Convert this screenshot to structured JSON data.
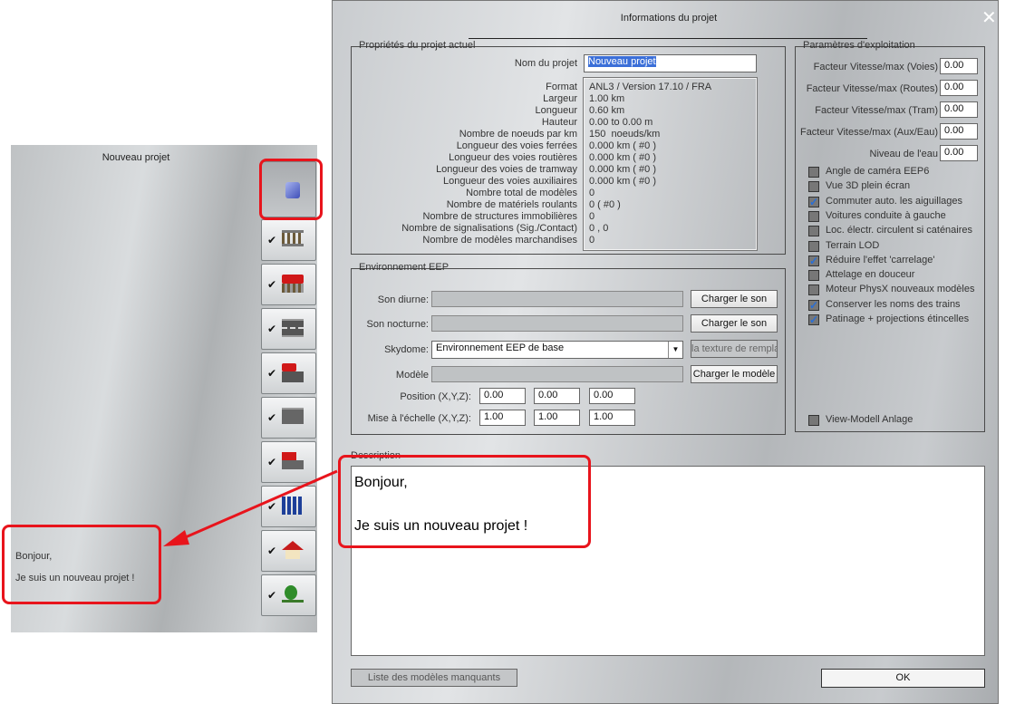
{
  "left_panel": {
    "title": "Nouveau projet",
    "description_lines": [
      "Bonjour,",
      "Je suis un nouveau projet !"
    ],
    "sidebar_buttons": [
      {
        "icon": "cube-icon",
        "checked": false,
        "selected": true
      },
      {
        "icon": "railway-track-icon",
        "checked": true
      },
      {
        "icon": "train-on-track-icon",
        "checked": true
      },
      {
        "icon": "road-icon",
        "checked": true
      },
      {
        "icon": "car-on-road-icon",
        "checked": true
      },
      {
        "icon": "tram-track-icon",
        "checked": true
      },
      {
        "icon": "tram-vehicle-icon",
        "checked": true
      },
      {
        "icon": "people-icon",
        "checked": true
      },
      {
        "icon": "house-icon",
        "checked": true
      },
      {
        "icon": "tree-icon",
        "checked": true
      }
    ]
  },
  "dialog": {
    "title": "Informations du projet",
    "properties": {
      "legend": "Propriétés du projet actuel",
      "name_label": "Nom du projet",
      "name_value": "Nouveau projet",
      "rows": [
        [
          "Format",
          "ANL3 / Version 17.10 / FRA"
        ],
        [
          "Largeur",
          "1.00 km"
        ],
        [
          "Longueur",
          "0.60 km"
        ],
        [
          "Hauteur",
          "0.00 to 0.00 m"
        ],
        [
          "Nombre de noeuds par km",
          "150  noeuds/km"
        ],
        [
          "Longueur des voies ferrées",
          "0.000 km ( #0 )"
        ],
        [
          "Longueur des voies routières",
          "0.000 km ( #0 )"
        ],
        [
          "Longueur des voies de tramway",
          "0.000 km ( #0 )"
        ],
        [
          "Longueur des voies auxiliaires",
          "0.000 km ( #0 )"
        ],
        [
          "Nombre total de modèles",
          "0"
        ],
        [
          "Nombre de matériels roulants",
          "0 ( #0 )"
        ],
        [
          "Nombre de structures immobilières",
          "0"
        ],
        [
          "Nombre de signalisations (Sig./Contact)",
          "0 , 0"
        ],
        [
          "Nombre de modèles marchandises",
          "0"
        ]
      ]
    },
    "environment": {
      "legend": "Environnement EEP",
      "son_diurne_label": "Son diurne:",
      "son_nocturne_label": "Son nocturne:",
      "load_sound": "Charger le son",
      "skydome_label": "Skydome:",
      "skydome_value": "Environnement EEP de base",
      "texture_button": "la texture de rempla",
      "modele_label": "Modèle",
      "load_model": "Charger le modèle",
      "position_label": "Position (X,Y,Z):",
      "position": [
        "0.00",
        "0.00",
        "0.00"
      ],
      "scale_label": "Mise à l'échelle (X,Y,Z):",
      "scale": [
        "1.00",
        "1.00",
        "1.00"
      ]
    },
    "parameters": {
      "legend": "Paramètres d'exploitation",
      "fields": [
        [
          "Facteur Vitesse/max (Voies)",
          "0.00"
        ],
        [
          "Facteur Vitesse/max (Routes)",
          "0.00"
        ],
        [
          "Facteur Vitesse/max (Tram)",
          "0.00"
        ],
        [
          "Facteur Vitesse/max (Aux/Eau)",
          "0.00"
        ],
        [
          "Niveau de l'eau",
          "0.00"
        ]
      ],
      "checkboxes": [
        {
          "label": "Angle de caméra EEP6",
          "checked": false
        },
        {
          "label": "Vue 3D plein écran",
          "checked": false
        },
        {
          "label": "Commuter auto. les aiguillages",
          "checked": true
        },
        {
          "label": "Voitures conduite à gauche",
          "checked": false
        },
        {
          "label": "Loc. électr. circulent si caténaires",
          "checked": false
        },
        {
          "label": "Terrain LOD",
          "checked": false
        },
        {
          "label": "Réduire l'effet 'carrelage'",
          "checked": true
        },
        {
          "label": "Attelage en douceur",
          "checked": false
        },
        {
          "label": "Moteur PhysX nouveaux modèles",
          "checked": false
        },
        {
          "label": "Conserver les noms des trains",
          "checked": true
        },
        {
          "label": "Patinage + projections étincelles",
          "checked": true
        }
      ],
      "view_modell": {
        "label": "View-Modell Anlage",
        "checked": false
      }
    },
    "description_label": "Description",
    "description_lines": [
      "Bonjour,",
      "",
      "Je suis un nouveau projet !"
    ],
    "missing_models_button": "Liste des modèles manquants",
    "ok_button": "OK"
  },
  "colors": {
    "annotation": "#e8141c",
    "selection": "#3b6fd8",
    "check": "#2a6fd6"
  }
}
